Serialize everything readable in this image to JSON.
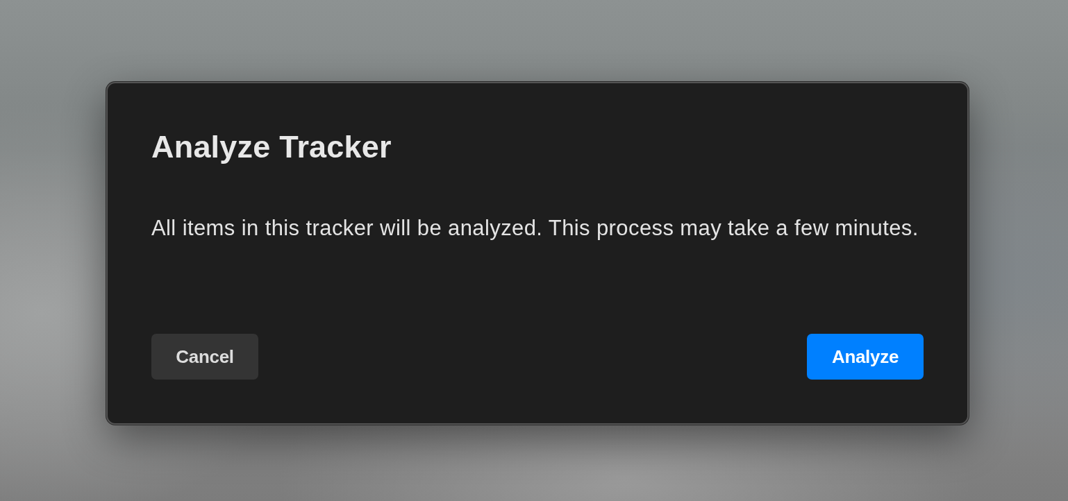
{
  "dialog": {
    "title": "Analyze Tracker",
    "message": "All items in this tracker will be analyzed. This process may take a few minutes.",
    "buttons": [
      {
        "label": "Cancel",
        "kind": "secondary"
      },
      {
        "label": "Analyze",
        "kind": "primary"
      }
    ]
  }
}
